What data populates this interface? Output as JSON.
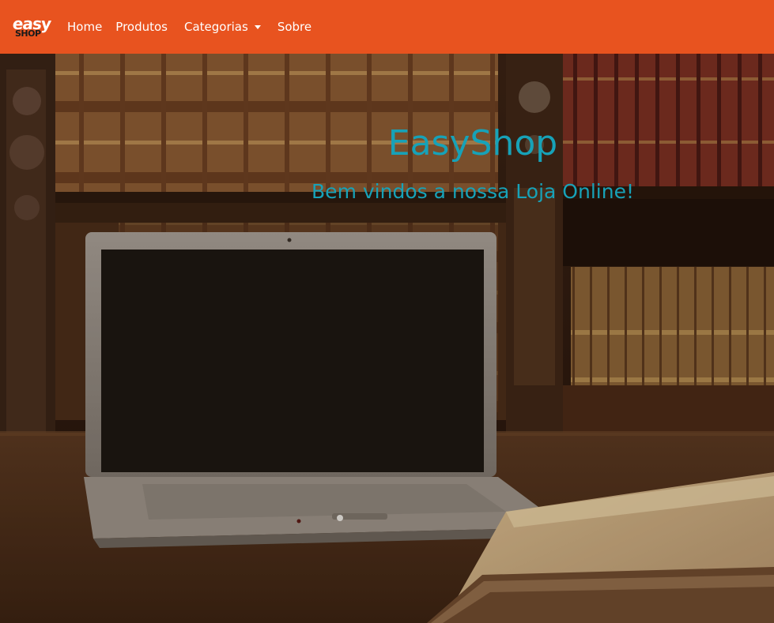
{
  "navbar": {
    "brand": {
      "top": "easy",
      "bottom": "SHOP"
    },
    "links": {
      "home": "Home",
      "produtos": "Produtos",
      "categorias": "Categorias",
      "sobre": "Sobre"
    },
    "color": "#e8531f"
  },
  "hero": {
    "title": "EasyShop",
    "subtitle": "Bem vindos a nossa Loja Online!",
    "text_color": "#17a2b8",
    "background_image": "laptop-and-books-library-photo"
  }
}
